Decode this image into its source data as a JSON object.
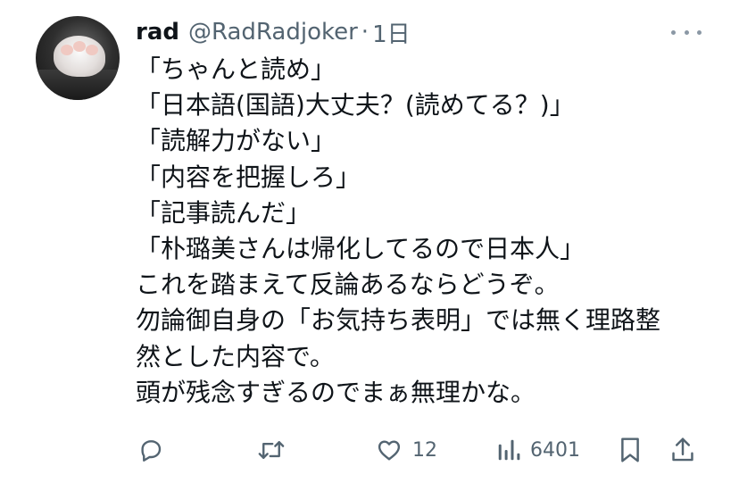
{
  "tweet": {
    "author": {
      "display_name": "rad",
      "handle": "@RadRadjoker",
      "separator": "·",
      "time": "1日"
    },
    "lines": [
      "「ちゃんと読め」",
      "「日本語(国語)大丈夫？(読めてる？)」",
      "「読解力がない」",
      "「内容を把握しろ」",
      "「記事読んだ」",
      "「朴璐美さんは帰化してるので日本人」",
      "これを踏まえて反論あるならどうぞ。",
      "勿論御自身の「お気持ち表明」では無く理路整",
      "然とした内容で。",
      "頭が残念すぎるのでまぁ無理かな。"
    ],
    "actions": {
      "reply_icon": "speech-bubble-icon",
      "retweet_icon": "retweet-arrows-icon",
      "like_icon": "heart-icon",
      "like_count": "12",
      "views_icon": "bar-chart-icon",
      "views_count": "6401",
      "bookmark_icon": "bookmark-icon",
      "share_icon": "share-upload-icon"
    },
    "colors": {
      "text": "#0f1419",
      "secondary": "#536471",
      "background": "#ffffff"
    }
  }
}
